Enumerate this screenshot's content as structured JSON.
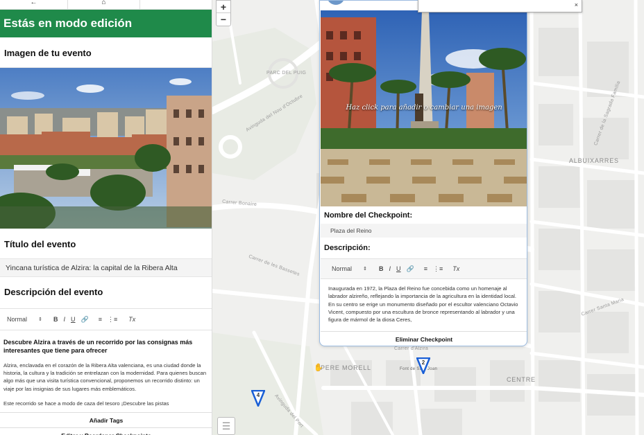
{
  "nav": {
    "back_icon": "arrow-left-icon",
    "home_icon": "home-icon"
  },
  "editor": {
    "banner": "Estás en modo edición",
    "image_heading": "Imagen de tu evento",
    "title_heading": "Título del evento",
    "title_value": "Yincana turística de Alzira: la capital de la Ribera Alta",
    "description_heading": "Descripción del evento",
    "toolbar": {
      "format": "Normal",
      "bold": "B",
      "italic": "I",
      "underline": "U",
      "clear": "Tx"
    },
    "description_lead": "Descubre Alzira a través de un recorrido por las consignas más interesantes que tiene para ofrecer",
    "description_body": "Alzira, enclavada en el corazón de la Ribera Alta valenciana, es una ciudad donde la historia, la cultura y la tradición se entrelazan con la modernidad. Para quienes buscan algo más que una visita turística convencional, proponemos un recorrido distinto: un viaje por las insignias de sus lugares más emblemáticos.",
    "description_tail": "Este recorrido se hace a modo de caza del tesoro ¡Descubre las pistas",
    "add_tags_button": "Añadir Tags",
    "edit_checkpoints_button": "Editar y Reordenar Checkpoints"
  },
  "checkpoint_popup": {
    "image_caption": "Haz click para añadir o cambiar una imagen",
    "name_heading": "Nombre del Checkpoint:",
    "name_value": "Plaza del Reino",
    "description_heading": "Descripción:",
    "toolbar": {
      "format": "Normal",
      "bold": "B",
      "italic": "I",
      "underline": "U",
      "clear": "Tx"
    },
    "description_text": "Inaugurada en 1972, la Plaza del Reino fue concebida como un homenaje al labrador alzireño, reflejando la importancia de la agricultura en la identidad local. En su centro se erige un monumento diseñado por el escultor valenciano Octavio Vicent, compuesto por una escultura de bronce representando al labrador y una figura de mármol de la diosa Ceres,",
    "delete_button": "Eliminar Checkpoint",
    "close_icon": "×"
  },
  "map": {
    "zoom_in": "+",
    "zoom_out": "−",
    "labels": {
      "parc": "PARC DEL PUIG",
      "albuixarres": "ALBUIXARRES",
      "pere_morell": "PERE MORELL",
      "centre": "CENTRE",
      "street1": "Avinguda del Nou d'Octubre",
      "street2": "Carrer Bonaire",
      "street3": "Carrer de les Bassetes",
      "street4": "Avinguda del Port",
      "street5": "Carrer de la Sagrada Família",
      "street6": "Carrer Santa Maria",
      "street7": "Carrer d'Alzira",
      "street8": "Font de Sant Joan"
    },
    "markers": [
      {
        "label": "2"
      },
      {
        "label": "4"
      }
    ],
    "marker_color": "#1a5fd6"
  }
}
